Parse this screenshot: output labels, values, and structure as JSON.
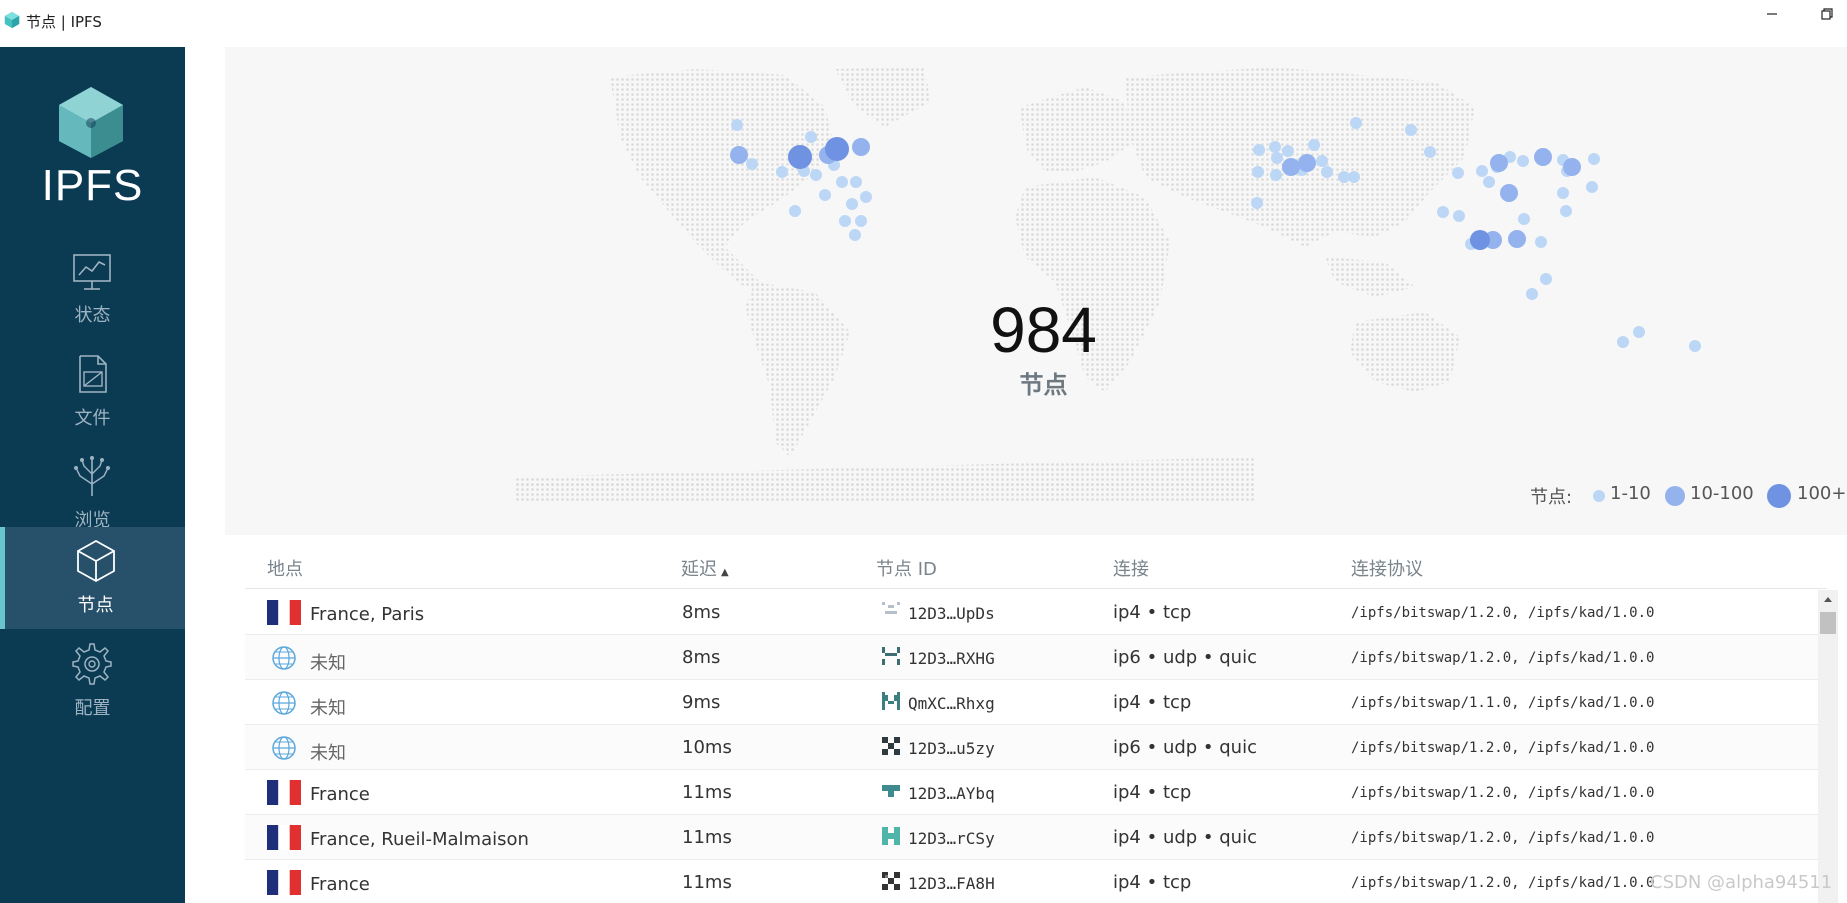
{
  "window": {
    "title": "节点 | IPFS"
  },
  "sidebar": {
    "logo_text": "IPFS",
    "items": [
      {
        "label": "状态",
        "icon": "status-icon"
      },
      {
        "label": "文件",
        "icon": "files-icon"
      },
      {
        "label": "浏览",
        "icon": "explore-icon"
      },
      {
        "label": "节点",
        "icon": "peers-icon",
        "active": true
      },
      {
        "label": "配置",
        "icon": "settings-icon"
      }
    ]
  },
  "map": {
    "peer_count": "984",
    "peer_label": "节点"
  },
  "legend": {
    "label": "节点:",
    "small": "1-10",
    "medium": "10-100",
    "large": "100+"
  },
  "table": {
    "headers": {
      "location": "地点",
      "latency": "延迟",
      "peer_id": "节点 ID",
      "connection": "连接",
      "protocols": "连接协议"
    },
    "rows": [
      {
        "location": "France, Paris",
        "flag": "france",
        "latency": "8ms",
        "peer_id": "12D3…UpDs",
        "connection": "ip4 • tcp",
        "protocols": "/ipfs/bitswap/1.2.0, /ipfs/kad/1.0.0"
      },
      {
        "location": "未知",
        "flag": "globe",
        "latency": "8ms",
        "peer_id": "12D3…RXHG",
        "connection": "ip6 • udp • quic",
        "protocols": "/ipfs/bitswap/1.2.0, /ipfs/kad/1.0.0"
      },
      {
        "location": "未知",
        "flag": "globe",
        "latency": "9ms",
        "peer_id": "QmXC…Rhxg",
        "connection": "ip4 • tcp",
        "protocols": "/ipfs/bitswap/1.1.0, /ipfs/kad/1.0.0"
      },
      {
        "location": "未知",
        "flag": "globe",
        "latency": "10ms",
        "peer_id": "12D3…u5zy",
        "connection": "ip6 • udp • quic",
        "protocols": "/ipfs/bitswap/1.2.0, /ipfs/kad/1.0.0"
      },
      {
        "location": "France",
        "flag": "france",
        "latency": "11ms",
        "peer_id": "12D3…AYbq",
        "connection": "ip4 • tcp",
        "protocols": "/ipfs/bitswap/1.2.0, /ipfs/kad/1.0.0"
      },
      {
        "location": "France, Rueil-Malmaison",
        "flag": "france",
        "latency": "11ms",
        "peer_id": "12D3…rCSy",
        "connection": "ip4 • udp • quic",
        "protocols": "/ipfs/bitswap/1.2.0, /ipfs/kad/1.0.0"
      },
      {
        "location": "France",
        "flag": "france",
        "latency": "11ms",
        "peer_id": "12D3…FA8H",
        "connection": "ip4 • tcp",
        "protocols": "/ipfs/bitswap/1.2.0, /ipfs/kad/1.0.0"
      }
    ]
  },
  "watermark": "CSDN @alpha94511",
  "colors": {
    "sidebar_bg": "#0b3a53",
    "sidebar_active": "#27506a",
    "accent": "#69c4cd",
    "dot_small": "#bcd6f6",
    "dot_medium": "#94b3ee",
    "dot_large": "#6f93e2"
  }
}
